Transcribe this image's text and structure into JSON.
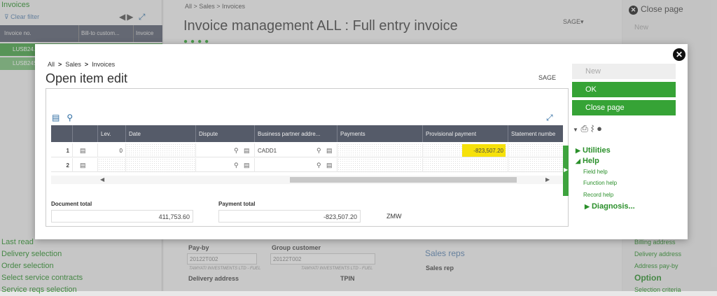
{
  "background": {
    "left_panel": {
      "title": "Invoices",
      "clear_filter": "Clear filter",
      "columns": [
        "Invoice no.",
        "Bill-to custom...",
        "Invoice"
      ],
      "rows": [
        "LUSB24...",
        "LUSB24S..."
      ],
      "links": [
        "Last read",
        "Delivery selection",
        "Order selection",
        "Select service contracts",
        "Service reqs selection"
      ]
    },
    "main": {
      "breadcrumb": "All > Sales > Invoices",
      "title": "Invoice management ALL : Full entry invoice",
      "sage": "SAGE▾",
      "form": {
        "pay_by_label": "Pay-by",
        "pay_by_value": "20122T002",
        "pay_by_sub": "TAMYATI INVESTMENTS LTD - FUEL",
        "group_customer_label": "Group customer",
        "group_customer_value": "20122T002",
        "group_customer_sub": "TAMYATI INVESTMENTS LTD - FUEL",
        "delivery_address_label": "Delivery address",
        "tpin_label": "TPIN",
        "sales_reps_title": "Sales reps",
        "sales_rep_label": "Sales rep"
      }
    },
    "right_panel": {
      "close_page": "Close page",
      "new": "New",
      "links": [
        "Billing address",
        "Delivery address",
        "Address pay-by"
      ],
      "option": "Option",
      "selection_criteria": "Selection criteria"
    }
  },
  "modal": {
    "breadcrumb": {
      "all": "All",
      "sales": "Sales",
      "invoices": "Invoices",
      "sep": ">"
    },
    "title": "Open item edit",
    "sage": "SAGE",
    "table": {
      "columns": [
        "Lev.",
        "Date",
        "Dispute",
        "Business partner addre...",
        "Payments",
        "Provisional payment",
        "Statement numbe"
      ],
      "rows": [
        {
          "num": "1",
          "lev": "0",
          "date": "",
          "dispute": "",
          "bp": "CADD1",
          "payments": "",
          "provisional": "-823,507.20"
        },
        {
          "num": "2",
          "lev": "",
          "date": "",
          "dispute": "",
          "bp": "",
          "payments": "",
          "provisional": ""
        }
      ]
    },
    "totals": {
      "document_total_label": "Document total",
      "document_total": "411,753.60",
      "payment_total_label": "Payment total",
      "payment_total": "-823,507.20",
      "currency": "ZMW"
    },
    "actions": {
      "new": "New",
      "ok": "OK",
      "close_page": "Close page",
      "utilities": "Utilities",
      "help": "Help",
      "field_help": "Field help",
      "function_help": "Function help",
      "record_help": "Record help",
      "diagnosis": "Diagnosis..."
    }
  }
}
